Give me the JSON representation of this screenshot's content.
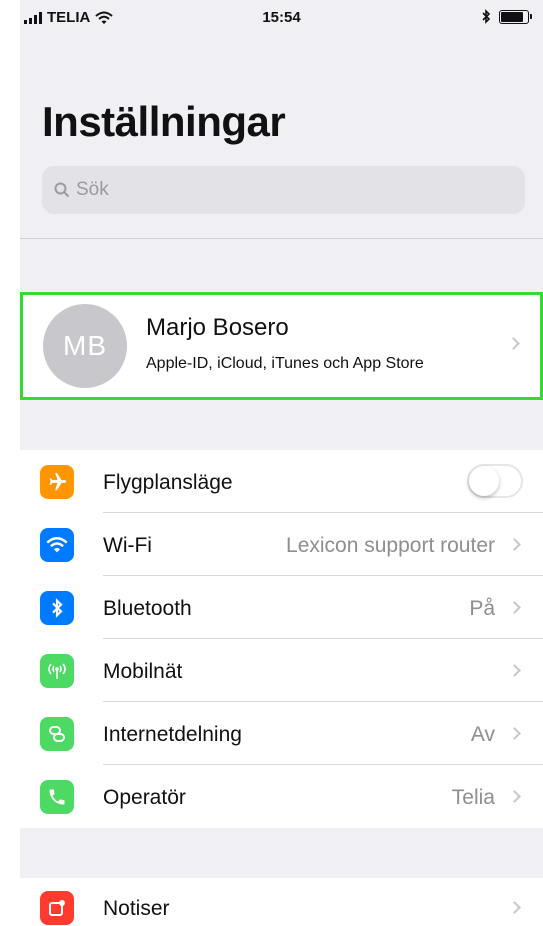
{
  "status_bar": {
    "carrier": "TELIA",
    "time": "15:54"
  },
  "page_title": "Inställningar",
  "search": {
    "placeholder": "Sök"
  },
  "profile": {
    "initials": "MB",
    "name": "Marjo Bosero",
    "subtitle": "Apple-ID, iCloud, iTunes och App Store",
    "highlight_color": "#2fdc2f"
  },
  "connectivity": [
    {
      "label": "Flygplansläge",
      "value": "",
      "icon": "airplane-icon",
      "color": "#ff9500",
      "toggle": false
    },
    {
      "label": "Wi-Fi",
      "value": "Lexicon support router",
      "icon": "wifi-icon",
      "color": "#007aff"
    },
    {
      "label": "Bluetooth",
      "value": "På",
      "icon": "bluetooth-icon",
      "color": "#007aff"
    },
    {
      "label": "Mobilnät",
      "value": "",
      "icon": "cellular-antenna-icon",
      "color": "#4cd964"
    },
    {
      "label": "Internetdelning",
      "value": "Av",
      "icon": "personal-hotspot-icon",
      "color": "#4cd964"
    },
    {
      "label": "Operatör",
      "value": "Telia",
      "icon": "phone-icon",
      "color": "#4cd964"
    }
  ],
  "notifications": [
    {
      "label": "Notiser",
      "icon": "notifications-icon",
      "color": "#ff3b30"
    }
  ]
}
